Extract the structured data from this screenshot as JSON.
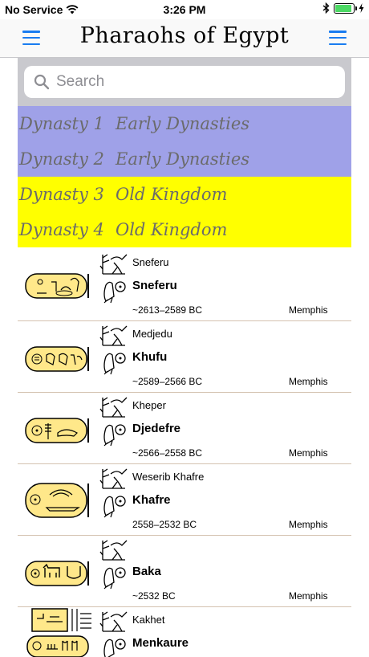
{
  "status_bar": {
    "carrier": "No Service",
    "time": "3:26 PM",
    "battery_level": 0.9
  },
  "nav": {
    "title": "Pharaohs of Egypt",
    "left_icon": "hamburger-menu-icon",
    "right_icon": "hamburger-menu-icon"
  },
  "search": {
    "placeholder": "Search"
  },
  "colors": {
    "accent": "#1a7cf0",
    "early_dynasty_bg": "#9fa1e8",
    "old_kingdom_bg": "#ffff00",
    "row_divider": "#d4c2b0",
    "cartouche_fill": "#ffe88a"
  },
  "dynasties": [
    {
      "number": "Dynasty 1",
      "period": "Early Dynasties"
    },
    {
      "number": "Dynasty 2",
      "period": "Early Dynasties"
    },
    {
      "number": "Dynasty 3",
      "period": "Old Kingdom"
    },
    {
      "number": "Dynasty 4",
      "period": "Old Kingdom"
    }
  ],
  "pharaohs": [
    {
      "epithet": "Sneferu",
      "name": "Sneferu",
      "dates": "~2613–2589 BC",
      "capital": "Memphis"
    },
    {
      "epithet": "Medjedu",
      "name": "Khufu",
      "dates": "~2589–2566 BC",
      "capital": "Memphis"
    },
    {
      "epithet": "Kheper",
      "name": "Djedefre",
      "dates": "~2566–2558 BC",
      "capital": "Memphis"
    },
    {
      "epithet": "Weserib Khafre",
      "name": "Khafre",
      "dates": "2558–2532 BC",
      "capital": "Memphis"
    },
    {
      "epithet": "",
      "name": "Baka",
      "dates": "~2532 BC",
      "capital": "Memphis"
    },
    {
      "epithet": "Kakhet",
      "name": "Menkaure",
      "dates": "",
      "capital": ""
    }
  ]
}
